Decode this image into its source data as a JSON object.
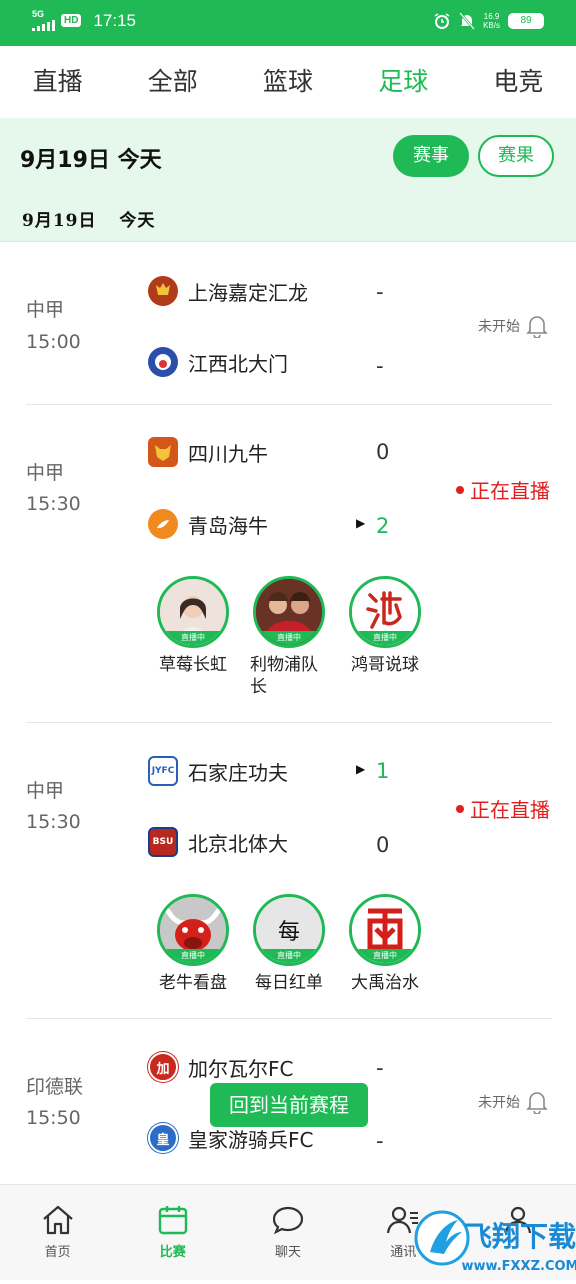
{
  "status_bar": {
    "network": "5G",
    "hd": "HD",
    "time": "17:15",
    "speed_value": "16.9",
    "speed_unit": "KB/s",
    "battery": "89"
  },
  "tabs": [
    {
      "label": "直播",
      "active": false
    },
    {
      "label": "全部",
      "active": false
    },
    {
      "label": "篮球",
      "active": false
    },
    {
      "label": "足球",
      "active": true
    },
    {
      "label": "电竞",
      "active": false
    }
  ],
  "date_header": {
    "title": "9月19日 今天",
    "events_button": "赛事",
    "results_button": "赛果",
    "sub_date": "9月19日",
    "sub_today": "今天"
  },
  "matches": [
    {
      "league": "中甲",
      "time": "15:00",
      "home": {
        "name": "上海嘉定汇龙",
        "score": "-",
        "logo_color": "#b03a1a"
      },
      "away": {
        "name": "江西北大门",
        "score": "-",
        "logo_color": "#2a4fa8"
      },
      "status": "未开始",
      "status_icon": "bell-icon"
    },
    {
      "league": "中甲",
      "time": "15:30",
      "home": {
        "name": "四川九牛",
        "score": "0",
        "logo_color": "#d4571a"
      },
      "away": {
        "name": "青岛海牛",
        "score": "2",
        "logo_color": "#f08a1e"
      },
      "status": "正在直播",
      "anchors": [
        {
          "name": "草莓长虹",
          "tag": "直播中"
        },
        {
          "name": "利物浦队长",
          "tag": "直播中"
        },
        {
          "name": "鸿哥说球",
          "tag": "直播中"
        }
      ]
    },
    {
      "league": "中甲",
      "time": "15:30",
      "home": {
        "name": "石家庄功夫",
        "score": "1",
        "logo_color": "#2a5fb8"
      },
      "away": {
        "name": "北京北体大",
        "score": "0",
        "logo_color": "#b8281e"
      },
      "status": "正在直播",
      "anchors": [
        {
          "name": "老牛看盘",
          "tag": "直播中"
        },
        {
          "name": "每日红单",
          "tag": "直播中"
        },
        {
          "name": "大禹治水",
          "tag": "直播中"
        }
      ]
    },
    {
      "league": "印德联",
      "time": "15:50",
      "home": {
        "name": "加尔瓦尔FC",
        "score": "-",
        "logo_color": "#c8281e",
        "logo_text": "加"
      },
      "away": {
        "name": "皇家游骑兵FC",
        "score": "-",
        "logo_color": "#2a6cc8",
        "logo_text": "皇"
      },
      "status": "未开始",
      "status_icon": "bell-icon"
    }
  ],
  "float_button": "回到当前赛程",
  "bottom_nav": [
    {
      "label": "首页",
      "icon": "home-icon",
      "active": false
    },
    {
      "label": "比赛",
      "icon": "calendar-icon",
      "active": true
    },
    {
      "label": "聊天",
      "icon": "chat-icon",
      "active": false
    },
    {
      "label": "通讯",
      "icon": "contacts-icon",
      "active": false
    },
    {
      "label": "",
      "icon": "profile-icon",
      "active": false
    }
  ],
  "watermark": {
    "text": "飞翔下载",
    "url": "www.FXXZ.COM"
  }
}
